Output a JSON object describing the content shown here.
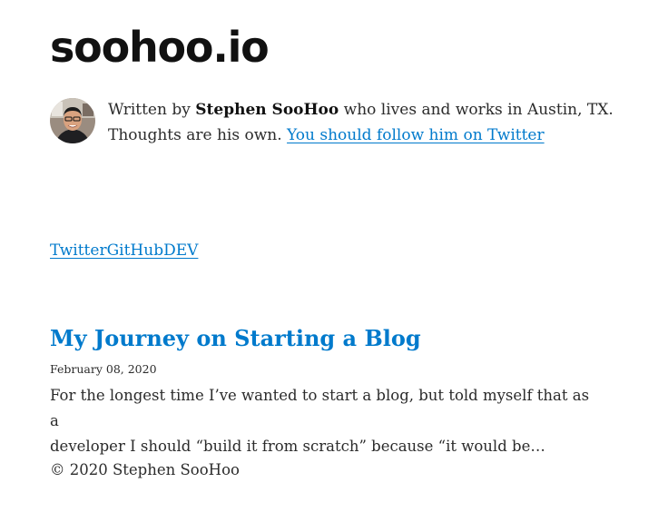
{
  "site": {
    "title": "soohoo.io"
  },
  "bio": {
    "written_by": "Written by ",
    "author": "Stephen SooHoo",
    "location_text": " who lives and works in Austin, TX.",
    "thoughts": "Thoughts are his own. ",
    "follow_link": "You should follow him on Twitter"
  },
  "social": {
    "links": [
      "Twitter",
      "GitHub",
      "DEV"
    ]
  },
  "post": {
    "title": "My Journey on Starting a Blog",
    "date": "February 08, 2020",
    "excerpt_line1": "For the longest time I’ve wanted to start a blog, but told myself that as a",
    "excerpt_line2": "developer I should “build it from scratch” because “it would be…"
  },
  "footer": {
    "copyright": "© 2020 Stephen SooHoo"
  },
  "colors": {
    "link": "#007acc",
    "text": "#2b2b2b",
    "title": "#111111"
  },
  "icons": {
    "avatar": "author-photo"
  }
}
